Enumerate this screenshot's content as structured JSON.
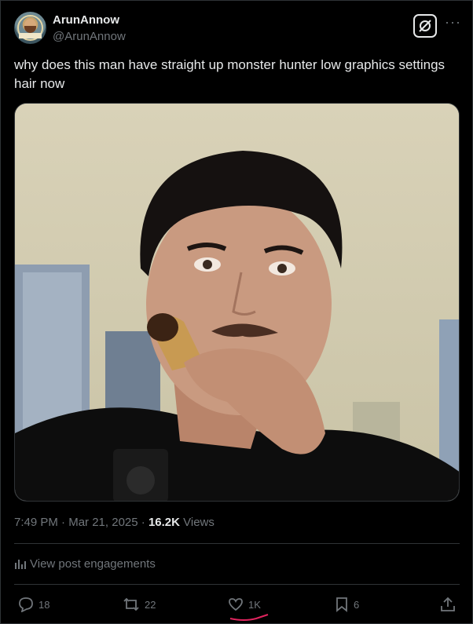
{
  "author": {
    "display_name": "ArunAnnow",
    "handle": "@ArunAnnow",
    "avatar_icon": "avatar-image"
  },
  "tweet": {
    "text": "why does this man have straight up monster hunter low graphics settings hair now",
    "media_description_icon": "video-thumbnail"
  },
  "meta": {
    "time": "7:49 PM",
    "separator1": " · ",
    "date": "Mar 21, 2025",
    "separator2": " · ",
    "views_count": "16.2K",
    "views_label": " Views"
  },
  "engagement_link": "View post engagements",
  "actions": {
    "replies": "18",
    "reposts": "22",
    "likes": "1K",
    "bookmarks": "6"
  },
  "colors": {
    "background": "#000000",
    "text": "#e7e9ea",
    "muted": "#71767b",
    "border": "#2f3336",
    "annotation_red": "#e0245e"
  }
}
